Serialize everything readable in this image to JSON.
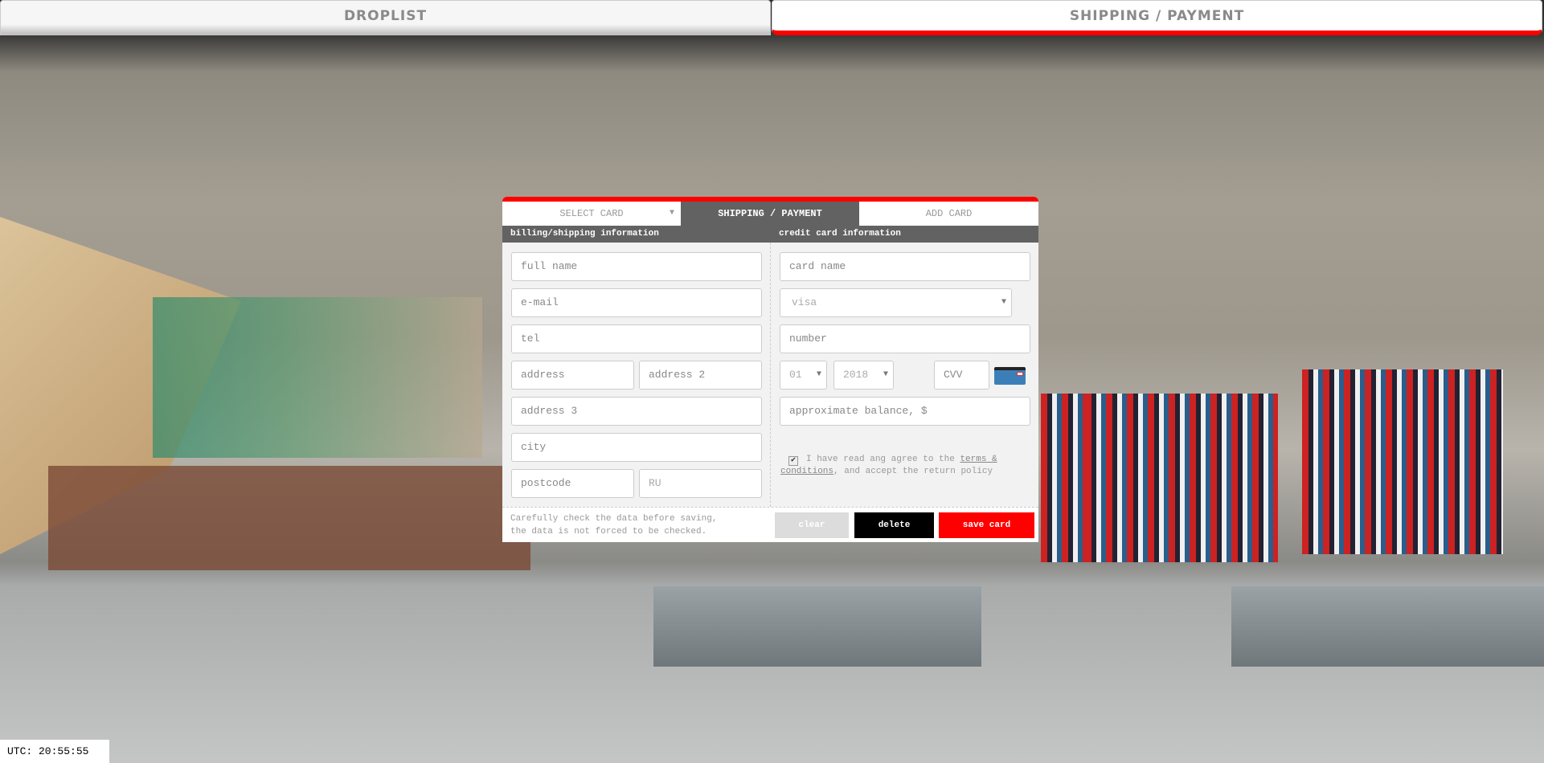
{
  "top_tabs": {
    "droplist": "DROPLIST",
    "shipping": "SHIPPING / PAYMENT"
  },
  "modal": {
    "tabs": {
      "select_card": "SELECT CARD",
      "shipping": "SHIPPING / PAYMENT",
      "add_card": "ADD CARD"
    },
    "billing_header": "billing/shipping information",
    "card_header": "credit card information",
    "billing": {
      "full_name": "full name",
      "email": "e-mail",
      "tel": "tel",
      "address": "address",
      "address2": "address 2",
      "address3": "address 3",
      "city": "city",
      "postcode": "postcode",
      "country": "RU"
    },
    "card": {
      "card_name": "card name",
      "type": "visa",
      "number": "number",
      "month": "01",
      "year": "2018",
      "cvv": "CVV",
      "balance": "approximate balance, $"
    },
    "terms": {
      "before": "I have read ang agree to the ",
      "link": "terms & conditions",
      "after": ", and accept the return policy",
      "checked": true
    },
    "note": [
      "Carefully check the data before saving,",
      "the data is not forced to be checked."
    ],
    "buttons": {
      "clear": "clear",
      "delete": "delete",
      "save": "save card"
    },
    "colors": {
      "accent": "#ff0000",
      "header": "#626262"
    }
  },
  "utc": "UTC: 20:55:55"
}
